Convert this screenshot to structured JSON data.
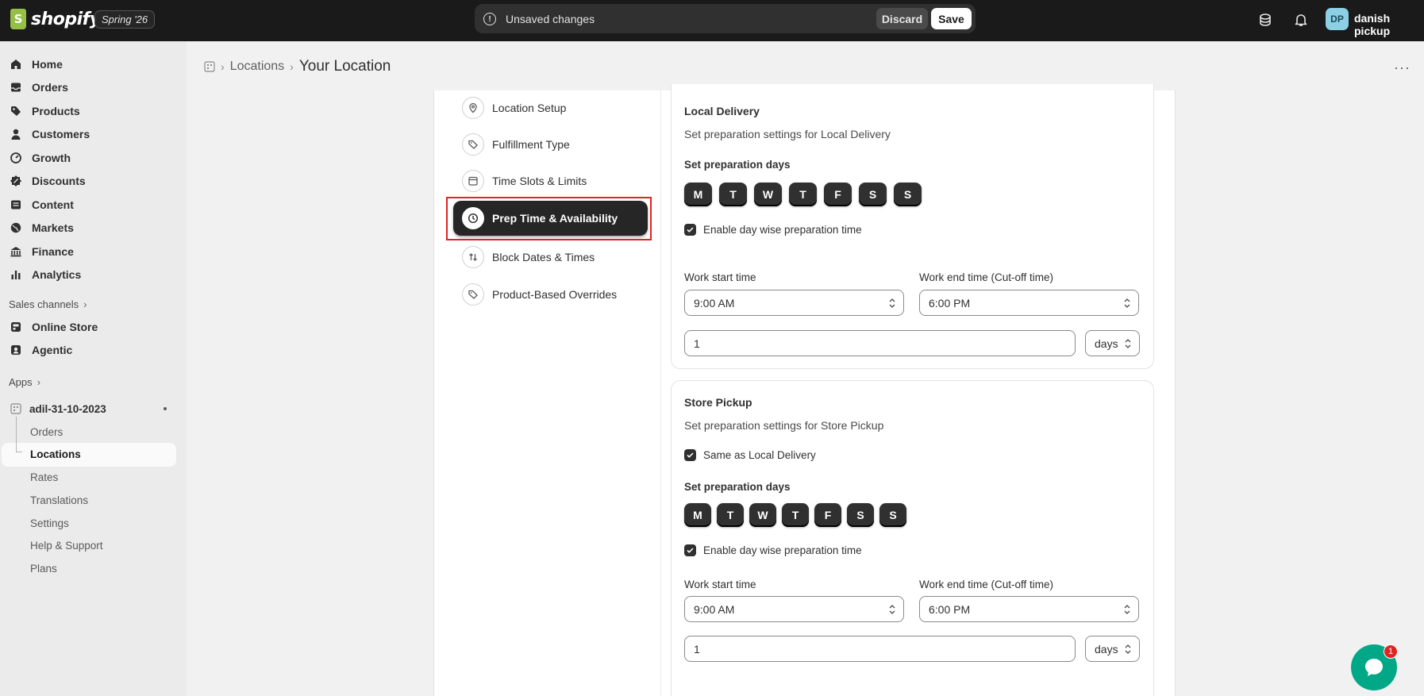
{
  "topbar": {
    "logo_text": "shopify",
    "edition": "Spring '26",
    "unsaved_message": "Unsaved changes",
    "discard_label": "Discard",
    "save_label": "Save",
    "avatar_initials": "DP",
    "username": "danish pickup"
  },
  "sidebar": {
    "items": [
      {
        "label": "Home",
        "icon": "home-icon"
      },
      {
        "label": "Orders",
        "icon": "inbox-icon"
      },
      {
        "label": "Products",
        "icon": "tag-icon"
      },
      {
        "label": "Customers",
        "icon": "person-icon"
      },
      {
        "label": "Growth",
        "icon": "gauge-icon"
      },
      {
        "label": "Discounts",
        "icon": "discount-icon"
      },
      {
        "label": "Content",
        "icon": "content-icon"
      },
      {
        "label": "Markets",
        "icon": "globe-icon"
      },
      {
        "label": "Finance",
        "icon": "bank-icon"
      },
      {
        "label": "Analytics",
        "icon": "bar-chart-icon"
      }
    ],
    "sales_channels_label": "Sales channels",
    "channels": [
      {
        "label": "Online Store",
        "icon": "store-icon"
      },
      {
        "label": "Agentic",
        "icon": "agentic-icon"
      }
    ],
    "apps_label": "Apps",
    "app_name": "adil-31-10-2023",
    "app_subitems": [
      "Orders",
      "Locations",
      "Rates",
      "Translations",
      "Settings",
      "Help & Support",
      "Plans"
    ],
    "app_active": "Locations"
  },
  "header": {
    "breadcrumb_link": "Locations",
    "title": "Your Location"
  },
  "tabs": [
    {
      "label": "Location Setup",
      "icon": "location-pin-icon"
    },
    {
      "label": "Fulfillment Type",
      "icon": "tag-icon"
    },
    {
      "label": "Time Slots & Limits",
      "icon": "calendar-icon"
    },
    {
      "label": "Prep Time & Availability",
      "icon": "clock-icon",
      "active": true
    },
    {
      "label": "Block Dates & Times",
      "icon": "arrows-icon"
    },
    {
      "label": "Product-Based Overrides",
      "icon": "tag-icon"
    }
  ],
  "local_delivery": {
    "title": "Local Delivery",
    "subtitle": "Set preparation settings for Local Delivery",
    "days_label": "Set preparation days",
    "days": [
      "M",
      "T",
      "W",
      "T",
      "F",
      "S",
      "S"
    ],
    "day_wise_label": "Enable day wise preparation time",
    "start_label": "Work start time",
    "start_value": "9:00 AM",
    "end_label": "Work end time (Cut-off time)",
    "end_value": "6:00 PM",
    "prep_value": "1",
    "unit_value": "days"
  },
  "store_pickup": {
    "title": "Store Pickup",
    "subtitle": "Set preparation settings for Store Pickup",
    "same_as_label": "Same as Local Delivery",
    "days_label": "Set preparation days",
    "days": [
      "M",
      "T",
      "W",
      "T",
      "F",
      "S",
      "S"
    ],
    "day_wise_label": "Enable day wise preparation time",
    "start_label": "Work start time",
    "start_value": "9:00 AM",
    "end_label": "Work end time (Cut-off time)",
    "end_value": "6:00 PM",
    "prep_value": "1",
    "unit_value": "days"
  },
  "chat": {
    "badge": "1"
  }
}
